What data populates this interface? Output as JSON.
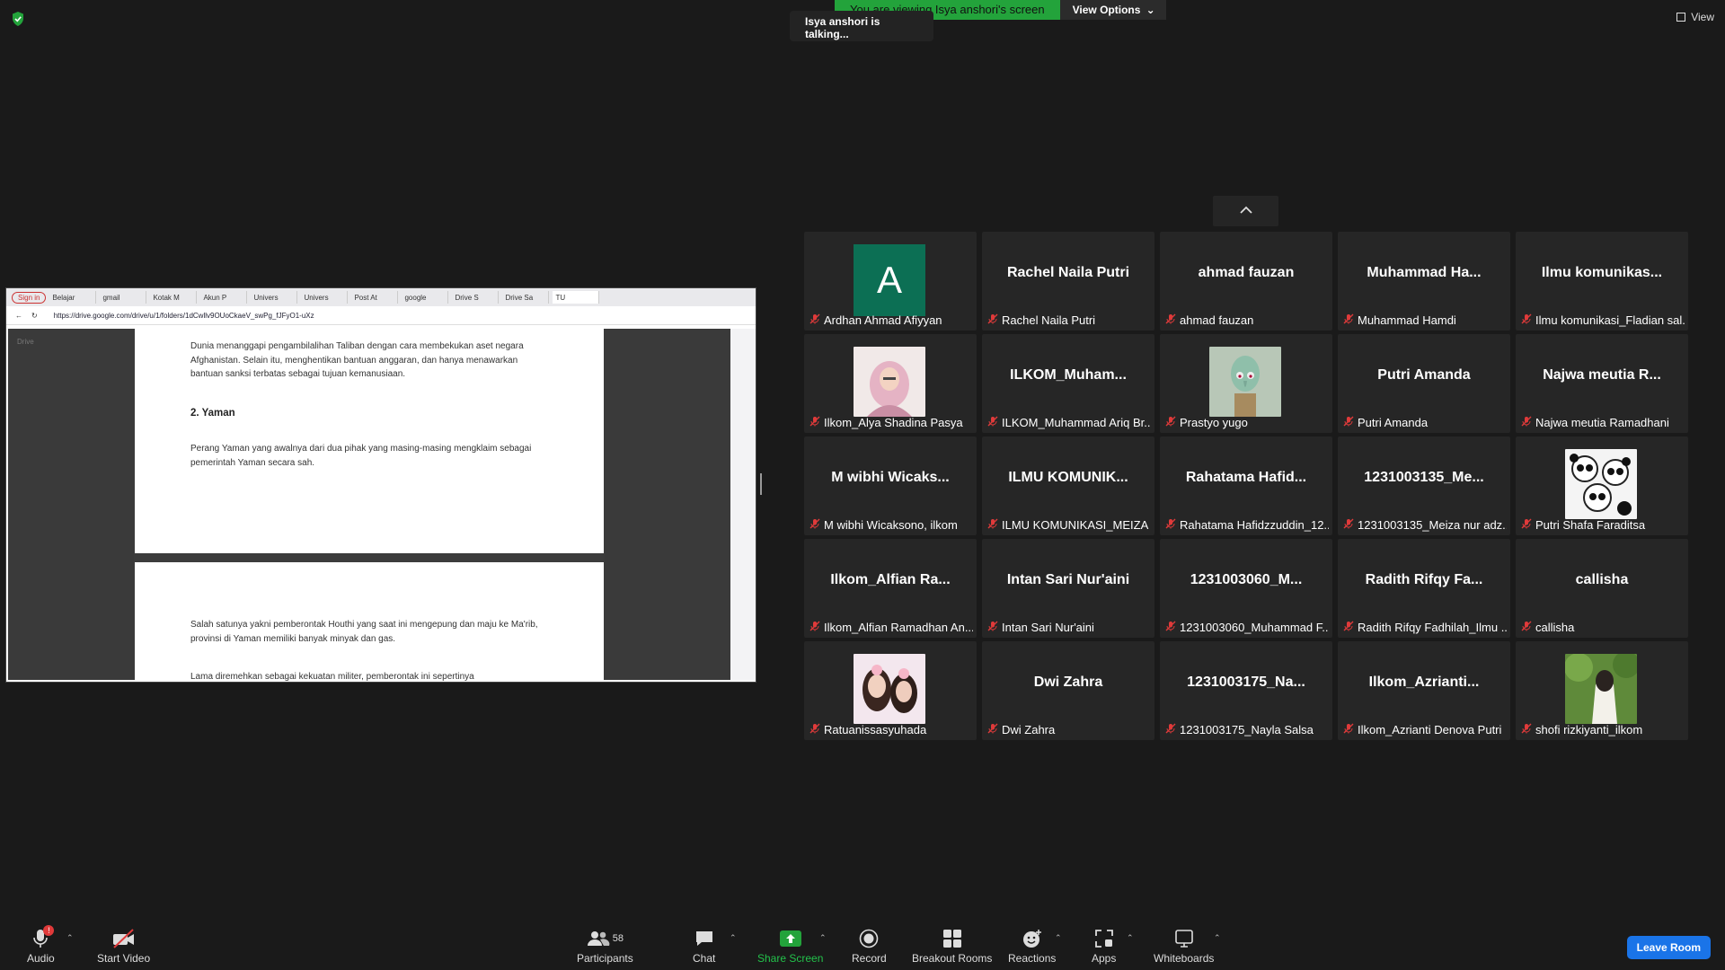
{
  "banner": {
    "viewing_text": "You are viewing Isya anshori's screen",
    "view_options": "View Options",
    "talking": "Isya anshori is talking...",
    "view_label": "View"
  },
  "shared_screen": {
    "browser": {
      "signin": "Sign in",
      "tabs": [
        "Belajar",
        "gmail",
        "Kotak M",
        "Akun P",
        "Univers",
        "Univers",
        "Post At",
        "google",
        "Drive S",
        "Drive Sa",
        "TU"
      ],
      "url": "https://drive.google.com/drive/u/1/folders/1dCwllv9OUoCkaeV_swPg_fJFyO1-uXz"
    },
    "drive_title": "Drive",
    "doc": {
      "para1": "Dunia menanggapi pengambilalihan Taliban dengan cara membekukan aset negara Afghanistan. Selain itu, menghentikan bantuan anggaran, dan hanya menawarkan bantuan sanksi terbatas sebagai tujuan kemanusiaan.",
      "heading": "2. Yaman",
      "para2": "Perang Yaman yang awalnya dari dua pihak yang masing-masing mengklaim sebagai pemerintah Yaman secara sah.",
      "para3": "Salah satunya yakni pemberontak Houthi yang saat ini mengepung dan maju ke Ma'rib, provinsi di Yaman memiliki banyak minyak dan gas.",
      "para4": "Lama diremehkan sebagai kekuatan militer, pemberontak ini sepertinya"
    }
  },
  "participants": [
    {
      "big": "",
      "footer": "Ardhan Ahmad Afiyyan",
      "avatar": "A"
    },
    {
      "big": "Rachel Naila Putri",
      "footer": "Rachel Naila Putri"
    },
    {
      "big": "ahmad fauzan",
      "footer": "ahmad fauzan"
    },
    {
      "big": "Muhammad  Ha...",
      "footer": "Muhammad Hamdi"
    },
    {
      "big": "Ilmu  komunikas...",
      "footer": "Ilmu komunikasi_Fladian sal..."
    },
    {
      "big": "",
      "footer": "Ilkom_Alya Shadina Pasya",
      "photo": "hijab"
    },
    {
      "big": "ILKOM_Muham...",
      "footer": "ILKOM_Muhammad Ariq Br..."
    },
    {
      "big": "",
      "footer": "Prastyo yugo",
      "photo": "squidward"
    },
    {
      "big": "Putri Amanda",
      "footer": "Putri Amanda"
    },
    {
      "big": "Najwa meutia  R...",
      "footer": "Najwa meutia Ramadhani"
    },
    {
      "big": "M  wibhi  Wicaks...",
      "footer": "M wibhi Wicaksono, ilkom"
    },
    {
      "big": "ILMU  KOMUNIK...",
      "footer": "ILMU KOMUNIKASI_MEIZA ..."
    },
    {
      "big": "Rahatama  Hafid...",
      "footer": "Rahatama Hafidzzuddin_12..."
    },
    {
      "big": "1231003135_Me...",
      "footer": "1231003135_Meiza nur adz..."
    },
    {
      "big": "",
      "footer": "Putri Shafa Faraditsa",
      "photo": "pandas"
    },
    {
      "big": "Ilkom_Alfian  Ra...",
      "footer": "Ilkom_Alfian Ramadhan An..."
    },
    {
      "big": "Intan Sari Nur'aini",
      "footer": "Intan Sari Nur'aini"
    },
    {
      "big": "1231003060_M...",
      "footer": "1231003060_Muhammad F..."
    },
    {
      "big": "Radith  Rifqy  Fa...",
      "footer": "Radith Rifqy Fadhilah_Ilmu ..."
    },
    {
      "big": "callisha",
      "footer": "callisha"
    },
    {
      "big": "",
      "footer": "Ratuanissasyuhada",
      "photo": "girls"
    },
    {
      "big": "Dwi Zahra",
      "footer": "Dwi Zahra"
    },
    {
      "big": "1231003175_Na...",
      "footer": "1231003175_Nayla Salsa"
    },
    {
      "big": "Ilkom_Azrianti...",
      "footer": "Ilkom_Azrianti Denova Putri"
    },
    {
      "big": "",
      "footer": "shofi rizkiyanti_ilkom",
      "photo": "nature"
    }
  ],
  "toolbar": {
    "audio": "Audio",
    "audio_badge": "!",
    "start_video": "Start Video",
    "participants": "Participants",
    "participants_count": "58",
    "chat": "Chat",
    "share_screen": "Share Screen",
    "record": "Record",
    "breakout_rooms": "Breakout Rooms",
    "reactions": "Reactions",
    "apps": "Apps",
    "whiteboards": "Whiteboards",
    "leave_room": "Leave Room"
  },
  "colors": {
    "share_green": "#23a33b",
    "leave_blue": "#1a74e8",
    "mute_red": "#e03a3a",
    "avatar_green": "#0c6f54"
  }
}
